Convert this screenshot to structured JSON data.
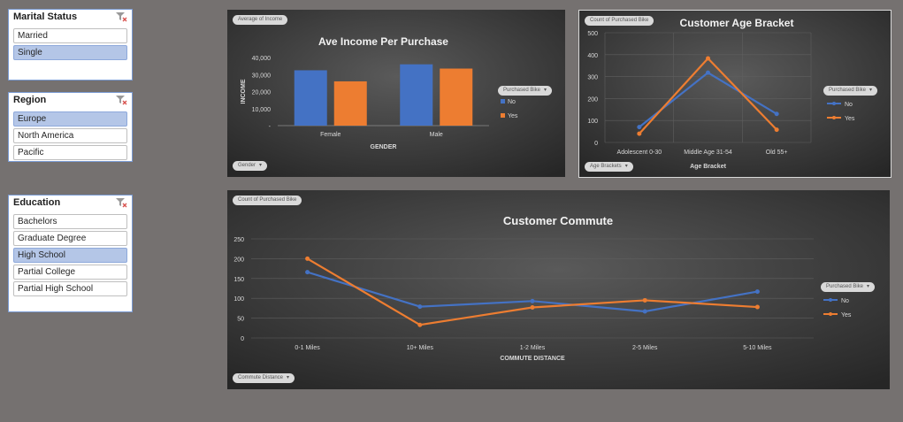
{
  "slicers": {
    "marital": {
      "title": "Marital Status",
      "items": [
        {
          "label": "Married",
          "selected": false
        },
        {
          "label": "Single",
          "selected": true
        }
      ]
    },
    "region": {
      "title": "Region",
      "items": [
        {
          "label": "Europe",
          "selected": true
        },
        {
          "label": "North America",
          "selected": false
        },
        {
          "label": "Pacific",
          "selected": false
        }
      ]
    },
    "education": {
      "title": "Education",
      "items": [
        {
          "label": "Bachelors",
          "selected": false
        },
        {
          "label": "Graduate Degree",
          "selected": false
        },
        {
          "label": "High School",
          "selected": true
        },
        {
          "label": "Partial College",
          "selected": false
        },
        {
          "label": "Partial High School",
          "selected": false
        }
      ]
    }
  },
  "charts": {
    "income": {
      "value_button": "Average of Income",
      "axis_button": "Gender",
      "legend_button": "Purchased Bike"
    },
    "age": {
      "value_button": "Count of Purchased Bike",
      "axis_button": "Age Brackets",
      "legend_button": "Purchased Bike"
    },
    "commute": {
      "value_button": "Count of Purchased Bike",
      "axis_button": "Commute Distance",
      "legend_button": "Purchased Bike"
    }
  },
  "colors": {
    "no": "#4472c4",
    "yes": "#ed7d31"
  },
  "chart_data": [
    {
      "id": "income",
      "type": "bar",
      "title": "Ave Income Per Purchase",
      "xlabel": "GENDER",
      "ylabel": "INCOME",
      "categories": [
        "Female",
        "Male"
      ],
      "series": [
        {
          "name": "No",
          "values": [
            32500,
            36000
          ]
        },
        {
          "name": "Yes",
          "values": [
            26000,
            33500
          ]
        }
      ],
      "ylim": [
        0,
        40000
      ],
      "yticks": [
        "-",
        "10,000",
        "20,000",
        "30,000",
        "40,000"
      ],
      "legend": "right"
    },
    {
      "id": "age",
      "type": "line",
      "title": "Customer Age Bracket",
      "xlabel": "Age Bracket",
      "ylabel": "",
      "categories": [
        "Adolescent 0-30",
        "Middle Age 31-54",
        "Old 55+"
      ],
      "series": [
        {
          "name": "No",
          "values": [
            70,
            318,
            130
          ]
        },
        {
          "name": "Yes",
          "values": [
            40,
            383,
            58
          ]
        }
      ],
      "ylim": [
        0,
        500
      ],
      "yticks": [
        "0",
        "100",
        "200",
        "300",
        "400",
        "500"
      ],
      "legend": "right"
    },
    {
      "id": "commute",
      "type": "line",
      "title": "Customer Commute",
      "xlabel": "COMMUTE DISTANCE",
      "ylabel": "",
      "categories": [
        "0-1 Miles",
        "10+ Miles",
        "1-2 Miles",
        "2-5 Miles",
        "5-10 Miles"
      ],
      "series": [
        {
          "name": "No",
          "values": [
            166,
            79,
            93,
            67,
            117
          ]
        },
        {
          "name": "Yes",
          "values": [
            200,
            33,
            77,
            95,
            78
          ]
        }
      ],
      "ylim": [
        0,
        250
      ],
      "yticks": [
        "0",
        "50",
        "100",
        "150",
        "200",
        "250"
      ],
      "legend": "right"
    }
  ]
}
